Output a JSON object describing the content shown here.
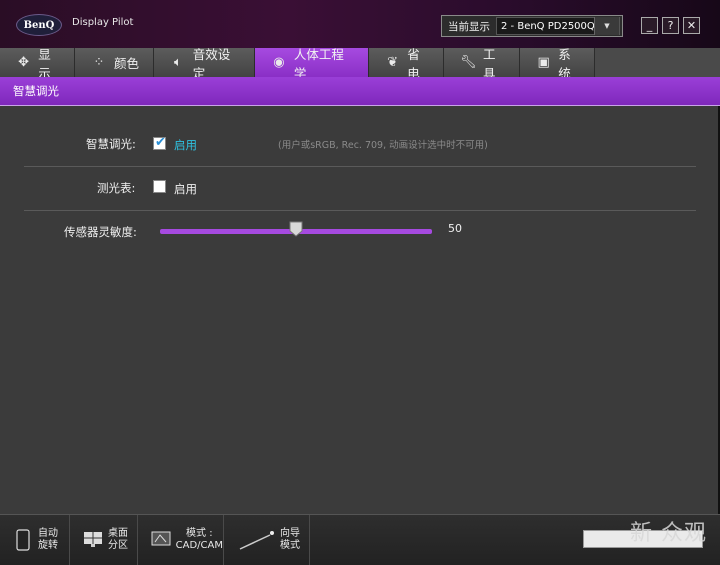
{
  "titlebar": {
    "logo": "BenQ",
    "app_title": "Display Pilot",
    "current_monitor_label": "当前显示",
    "monitor_value": "2 - BenQ PD2500Q",
    "minimize": "_",
    "help": "?",
    "close": "✕"
  },
  "tabs": [
    {
      "label": "显示",
      "icon": "display-sparkle-icon"
    },
    {
      "label": "颜色",
      "icon": "color-dots-icon"
    },
    {
      "label": "音效设定",
      "icon": "speaker-icon"
    },
    {
      "label": "人体工程学",
      "icon": "eye-icon",
      "active": true
    },
    {
      "label": "省电",
      "icon": "leaf-icon"
    },
    {
      "label": "工具",
      "icon": "wrench-icon"
    },
    {
      "label": "系统",
      "icon": "system-icon"
    }
  ],
  "subbar": {
    "title": "智慧调光"
  },
  "settings": {
    "smart_dimming": {
      "label": "智慧调光:",
      "checked": true,
      "enable_text": "启用",
      "note": "(用户或sRGB, Rec. 709, 动画设计选中时不可用)"
    },
    "light_meter": {
      "label": "测光表:",
      "checked": false,
      "enable_text": "启用"
    },
    "sensor_sensitivity": {
      "label": "传感器灵敏度:",
      "value": 50,
      "value_text": "50",
      "min": 0,
      "max": 100
    }
  },
  "bottom": {
    "auto_rotate": [
      "自动",
      "旋转"
    ],
    "desktop_partition": [
      "桌面",
      "分区"
    ],
    "mode_cad": [
      "模式 :",
      "CAD/CAM"
    ],
    "wizard_mode": [
      "向导",
      "模式"
    ]
  },
  "watermark": "新 众观",
  "colors": {
    "accent": "#a64ae0",
    "link": "#2fc2e0",
    "background": "#3b3b3b"
  }
}
